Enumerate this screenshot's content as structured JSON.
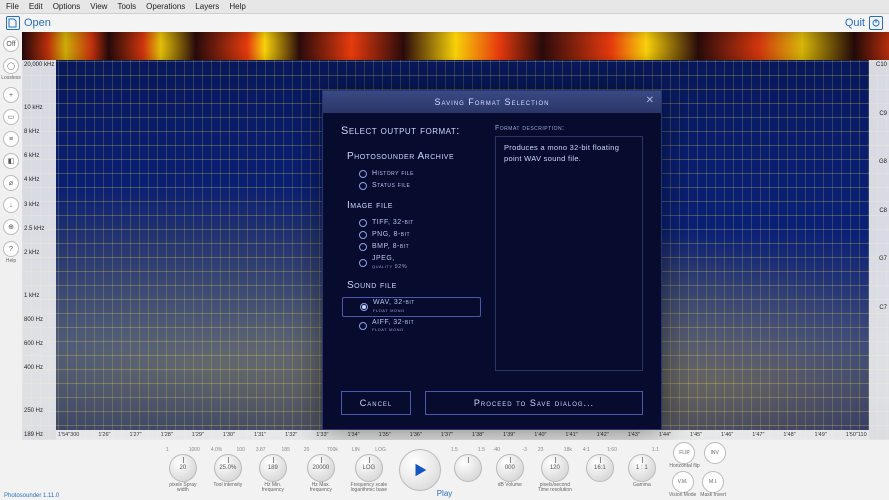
{
  "menu": [
    "File",
    "Edit",
    "Options",
    "View",
    "Tools",
    "Operations",
    "Layers",
    "Help"
  ],
  "topbar": {
    "open": "Open",
    "quit": "Quit"
  },
  "left_tools": [
    {
      "glyph": "Off",
      "label": "",
      "name": "off-button"
    },
    {
      "glyph": "◯",
      "label": "Lossless",
      "name": "lossless-button"
    },
    {
      "glyph": "+",
      "label": "",
      "name": "add-button"
    },
    {
      "glyph": "▭",
      "label": "",
      "name": "rect-tool"
    },
    {
      "glyph": "≡",
      "label": "",
      "name": "layers-tool"
    },
    {
      "glyph": "◧",
      "label": "",
      "name": "palette-tool"
    },
    {
      "glyph": "⌀",
      "label": "",
      "name": "measure-tool"
    },
    {
      "glyph": "↓",
      "label": "",
      "name": "download-tool"
    },
    {
      "glyph": "⊕",
      "label": "",
      "name": "loop-tool"
    },
    {
      "glyph": "?",
      "label": "Help",
      "name": "help-button"
    }
  ],
  "freq_ticks": [
    "20,000 kHz",
    "",
    "10 kHz",
    "8 kHz",
    "6 kHz",
    "4 kHz",
    "3 kHz",
    "2.5 kHz",
    "2 kHz",
    "",
    "1 kHz",
    "800 Hz",
    "600 Hz",
    "400 Hz",
    "",
    "250 Hz",
    "189 Hz"
  ],
  "note_ticks": [
    "C10",
    "",
    "C9",
    "",
    "G8",
    "",
    "C8",
    "",
    "G7",
    "",
    "C7",
    "",
    "",
    "",
    "",
    "",
    ""
  ],
  "time_ticks": [
    "1'54\"300",
    "1'26\"",
    "1'27\"",
    "1'28\"",
    "1'29\"",
    "1'30\"",
    "1'31\"",
    "1'32\"",
    "1'33\"",
    "1'34\"",
    "1'35\"",
    "1'36\"",
    "1'37\"",
    "1'38\"",
    "1'39\"",
    "1'40\"",
    "1'41\"",
    "1'42\"",
    "1'43\"",
    "1'44\"",
    "1'45\"",
    "1'46\"",
    "1'47\"",
    "1'48\"",
    "1'49\"",
    "1'50\"110"
  ],
  "knobs": [
    {
      "ticks": [
        "1",
        "1000"
      ],
      "val": "20",
      "label": "pixels\nSpray width"
    },
    {
      "ticks": [
        "4.0%",
        "100"
      ],
      "val": "25.0%",
      "label": "Tool intensity"
    },
    {
      "ticks": [
        "3.87",
        "185"
      ],
      "val": "189",
      "label": "Hz\nMin. frequency"
    },
    {
      "ticks": [
        "20",
        "700k"
      ],
      "val": "20000",
      "label": "Hz\nMax. frequency"
    },
    {
      "ticks": [
        "LIN",
        "LOG"
      ],
      "val": "LOG",
      "label": "Frequency scale\nlogarithmic base"
    },
    {
      "ticks": [
        "1.5",
        "1.5"
      ],
      "val": "",
      "label": ""
    },
    {
      "ticks": [
        "-40",
        "-3"
      ],
      "val": "000",
      "label": "dB\nVolume"
    },
    {
      "ticks": [
        "23",
        "18k"
      ],
      "val": "120",
      "label": "pixels/second\nTime resolution"
    },
    {
      "ticks": [
        "4:1",
        "1:60"
      ],
      "val": "16:1",
      "label": ""
    },
    {
      "ticks": [
        "",
        "1.1"
      ],
      "val": "1 : 1",
      "label": "Gamma"
    }
  ],
  "right_toggles": [
    {
      "val": "FLIP",
      "label": "Horizontal flip"
    },
    {
      "val": "INV",
      "label": ""
    },
    {
      "val": "V.M.",
      "label": "Vision Mode"
    },
    {
      "val": "M.I.",
      "label": "Mask\nInvert"
    }
  ],
  "play_label": "Play",
  "version": "Photosounder 1.11.0",
  "modal": {
    "title": "Saving Format Selection",
    "heading": "Select output format:",
    "sections": {
      "archive": {
        "label": "Photosounder Archive",
        "opts": [
          {
            "label": "History file",
            "sub": ""
          },
          {
            "label": "Status file",
            "sub": ""
          }
        ]
      },
      "image": {
        "label": "Image file",
        "opts": [
          {
            "label": "TIFF, 32-bit",
            "sub": ""
          },
          {
            "label": "PNG, 8-bit",
            "sub": ""
          },
          {
            "label": "BMP, 8-bit",
            "sub": ""
          },
          {
            "label": "JPEG,",
            "sub": "quality 92%"
          }
        ]
      },
      "sound": {
        "label": "Sound file",
        "opts": [
          {
            "label": "WAV, 32-bit",
            "sub": "float mono",
            "selected": true
          },
          {
            "label": "AIFF, 32-bit",
            "sub": "float mono"
          }
        ]
      }
    },
    "desc_label": "Format description:",
    "desc_text": "Produces a mono 32-bit floating point WAV sound file.",
    "cancel": "Cancel",
    "proceed": "Proceed to Save dialog..."
  }
}
